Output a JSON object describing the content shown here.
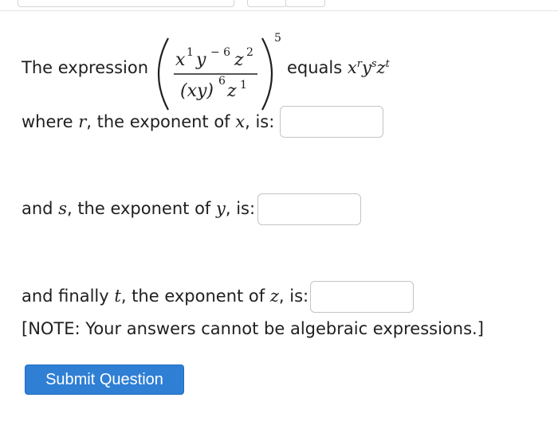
{
  "question": {
    "lead": "The expression",
    "equals_word": "equals",
    "expr": {
      "numerator": [
        {
          "base": "x",
          "exp": "1"
        },
        {
          "base": "y",
          "exp": "− 6"
        },
        {
          "base": "z",
          "exp": "2"
        }
      ],
      "denominator_group": {
        "base": "(xy)",
        "exp": "6"
      },
      "denominator_extra": {
        "base": "z",
        "exp": "1"
      },
      "outer_exponent": "5"
    },
    "result": [
      {
        "base": "x",
        "exp": "r"
      },
      {
        "base": "y",
        "exp": "s"
      },
      {
        "base": "z",
        "exp": "t"
      }
    ]
  },
  "prompts": [
    {
      "pre": "where ",
      "var": "r",
      "mid": ", the exponent of ",
      "of": "x",
      "post": ", is:"
    },
    {
      "pre": "and ",
      "var": "s",
      "mid": ", the exponent of ",
      "of": "y",
      "post": ", is:"
    },
    {
      "pre": "and finally ",
      "var": "t",
      "mid": ", the exponent of ",
      "of": "z",
      "post": ", is:"
    }
  ],
  "answers": [
    "",
    "",
    ""
  ],
  "note": "[NOTE: Your answers cannot be algebraic expressions.]",
  "submit_label": "Submit Question"
}
